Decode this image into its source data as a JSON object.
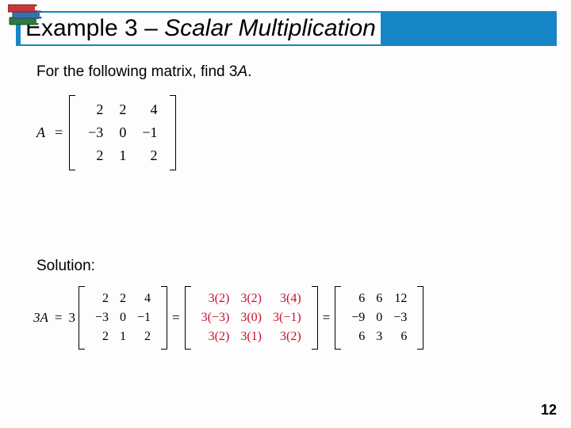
{
  "title": {
    "prefix": "Example 3 – ",
    "italic": "Scalar Multiplication"
  },
  "prompt": {
    "lead": "For the following matrix, find 3",
    "var": "A",
    "tail": "."
  },
  "matrixA": {
    "lhs": "A",
    "eq": "=",
    "rows": [
      [
        "2",
        "2",
        "4"
      ],
      [
        "−3",
        "0",
        "−1"
      ],
      [
        "2",
        "1",
        "2"
      ]
    ]
  },
  "solution_label": "Solution:",
  "solution": {
    "lhs": "3A",
    "eq": "=",
    "scalar": "3",
    "step1_rows": [
      [
        "2",
        "2",
        "4"
      ],
      [
        "−3",
        "0",
        "−1"
      ],
      [
        "2",
        "1",
        "2"
      ]
    ],
    "step2_rows": [
      [
        "3(2)",
        "3(2)",
        "3(4)"
      ],
      [
        "3(−3)",
        "3(0)",
        "3(−1)"
      ],
      [
        "3(2)",
        "3(1)",
        "3(2)"
      ]
    ],
    "step3_rows": [
      [
        "6",
        "6",
        "12"
      ],
      [
        "−9",
        "0",
        "−3"
      ],
      [
        "6",
        "3",
        "6"
      ]
    ]
  },
  "page_number": "12",
  "chart_data": {
    "type": "table",
    "title": "Scalar multiplication 3A",
    "A": [
      [
        2,
        2,
        4
      ],
      [
        -3,
        0,
        -1
      ],
      [
        2,
        1,
        2
      ]
    ],
    "scalar": 3,
    "result": [
      [
        6,
        6,
        12
      ],
      [
        -9,
        0,
        -3
      ],
      [
        6,
        3,
        6
      ]
    ]
  }
}
